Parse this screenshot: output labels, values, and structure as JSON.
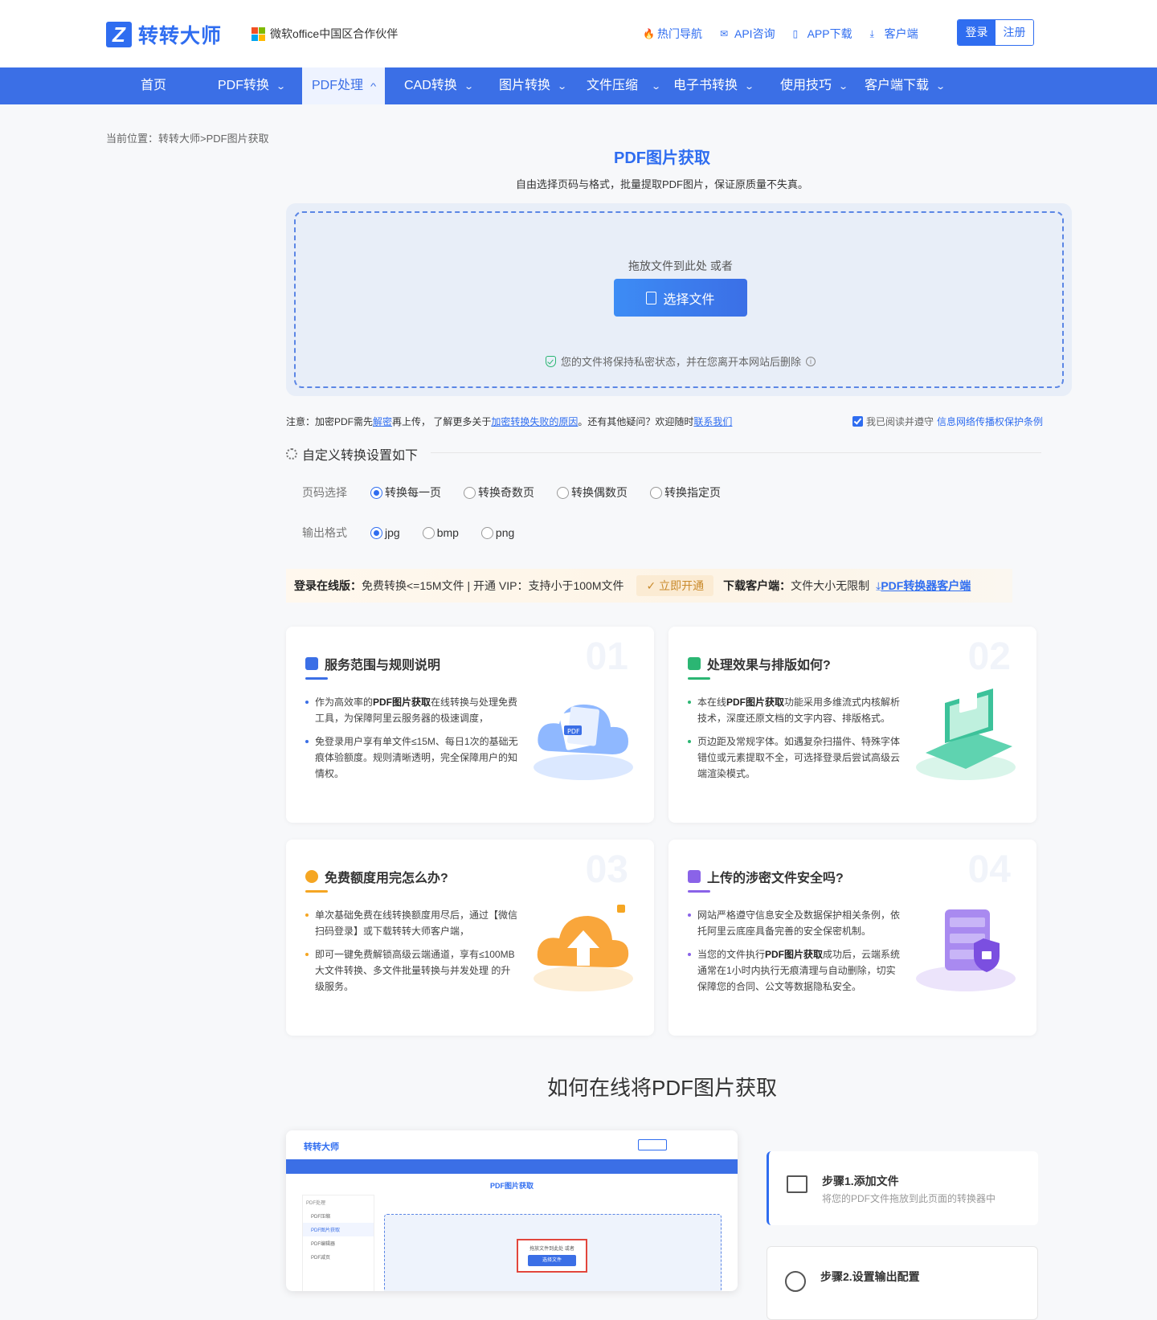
{
  "brand": {
    "logo_letter": "Z",
    "name": "转转大师",
    "partner": "微软office中国区合作伙伴"
  },
  "top_links": [
    {
      "label": "热门导航",
      "icon": "fire-icon"
    },
    {
      "label": "API咨询",
      "icon": "chat-icon"
    },
    {
      "label": "APP下载",
      "icon": "phone-icon"
    },
    {
      "label": "客户端",
      "icon": "download-icon"
    }
  ],
  "auth": {
    "login": "登录",
    "register": "注册"
  },
  "nav": [
    {
      "label": "首页"
    },
    {
      "label": "PDF转换",
      "chev": "⌄"
    },
    {
      "label": "PDF处理",
      "chev": "^"
    },
    {
      "label": "CAD转换",
      "chev": "⌄"
    },
    {
      "label": "图片转换",
      "chev": "⌄"
    },
    {
      "label": "文件压缩",
      "chev": "⌄"
    },
    {
      "label": "电子书转换",
      "chev": "⌄"
    },
    {
      "label": "使用技巧",
      "chev": "⌄"
    },
    {
      "label": "客户端下载",
      "chev": "⌄"
    }
  ],
  "breadcrumb": "当前位置：转转大师>PDF图片获取",
  "page": {
    "title": "PDF图片获取",
    "subtitle": "自由选择页码与格式，批量提取PDF图片，保证原质量不失真。"
  },
  "upload": {
    "drag_text": "拖放文件到此处 或者",
    "button": "选择文件",
    "privacy": "您的文件将保持私密状态，并在您离开本网站后删除"
  },
  "note": {
    "p1": "注意：加密PDF需先",
    "l1": "解密",
    "p2": "再上传， 了解更多关于",
    "l2": "加密转换失败的原因",
    "p3": "。还有其他疑问？欢迎随时",
    "l3": "联系我们",
    "agree_text": "我已阅读并遵守",
    "agree_link": "信息网络传播权保护条例"
  },
  "settings": {
    "title": "自定义转换设置如下",
    "page_label": "页码选择",
    "page_options": [
      "转换每一页",
      "转换奇数页",
      "转换偶数页",
      "转换指定页"
    ],
    "page_selected": 0,
    "format_label": "输出格式",
    "format_options": [
      "jpg",
      "bmp",
      "png"
    ],
    "format_selected": 0
  },
  "promo": {
    "online_label": "登录在线版：",
    "online_text": "免费转换<=15M文件 | 开通 VIP：支持小于100M文件",
    "vip_button": "立即开通",
    "client_label": "下载客户端：",
    "client_text": "文件大小无限制",
    "client_link": "PDF转换器客户端"
  },
  "cards": [
    {
      "num": "01",
      "title": "服务范围与规则说明",
      "accent": "#3b6fe6",
      "items": [
        {
          "bold": "",
          "pre": "作为高效率的",
          "b": "PDF图片获取",
          "post": "在线转换与处理免费工具，为保障阿里云服务器的极速调度，"
        },
        {
          "pre": "免登录用户享有单文件≤15M、每日1次的基础无痕体验额度。规则清晰透明，完全保障用户的知情权。",
          "b": "",
          "post": ""
        }
      ]
    },
    {
      "num": "02",
      "title": "处理效果与排版如何?",
      "accent": "#2bb673",
      "items": [
        {
          "pre": "本在线",
          "b": "PDF图片获取",
          "post": "功能采用多维流式内核解析技术，深度还原文档的文字内容、排版格式。"
        },
        {
          "pre": "页边距及常规字体。如遇复杂扫描件、特殊字体错位或元素提取不全，可选择登录后尝试高级云端渲染模式。",
          "b": "",
          "post": ""
        }
      ]
    },
    {
      "num": "03",
      "title": "免费额度用完怎么办?",
      "accent": "#f5a623",
      "items": [
        {
          "pre": "单次基础免费在线转换额度用尽后，通过【微信扫码登录】或下载转转大师客户端，",
          "b": "",
          "post": ""
        },
        {
          "pre": "即可一键免费解锁高级云端通道，享有≤100MB 大文件转换、多文件批量转换与并发处理 的升级服务。",
          "b": "",
          "post": ""
        }
      ]
    },
    {
      "num": "04",
      "title": "上传的涉密文件安全吗?",
      "accent": "#8a63e8",
      "items": [
        {
          "pre": "网站严格遵守信息安全及数据保护相关条例，依托阿里云底座具备完善的安全保密机制。",
          "b": "",
          "post": ""
        },
        {
          "pre": "当您的文件执行",
          "b": "PDF图片获取",
          "post": "成功后，云端系统通常在1小时内执行无痕清理与自动删除，切实保障您的合同、公文等数据隐私安全。"
        }
      ]
    }
  ],
  "howto": {
    "title": "如何在线将PDF图片获取"
  },
  "screenshot": {
    "brand": "转转大师",
    "title": "PDF图片获取",
    "drag": "拖放文件到此处 或者",
    "btn": "选择文件",
    "menu_head": "PDF处理",
    "menu": [
      "PDF压缩",
      "PDF图片获取",
      "PDF编辑器",
      "PDF减页"
    ]
  },
  "steps": [
    {
      "title": "步骤1.添加文件",
      "desc": "将您的PDF文件拖放到此页面的转换器中"
    },
    {
      "title": "步骤2.设置输出配置",
      "desc": ""
    }
  ]
}
